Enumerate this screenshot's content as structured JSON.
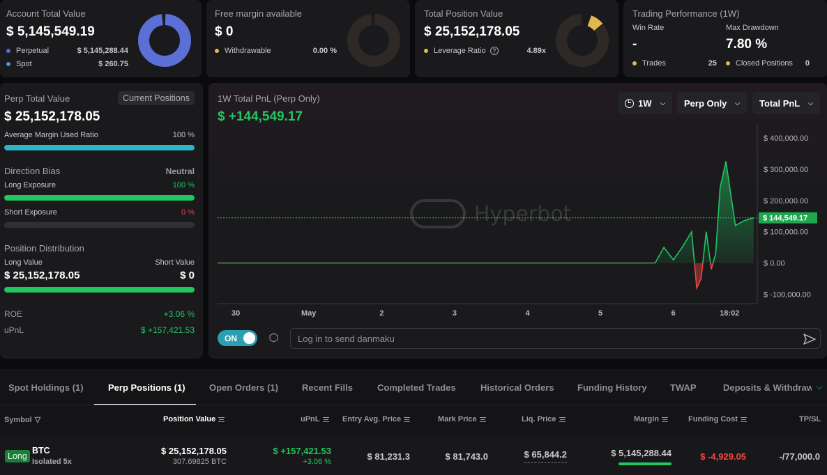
{
  "summary": {
    "account": {
      "title": "Account Total Value",
      "value": "$ 5,145,549.19",
      "perp_label": "Perpetual",
      "perp_value": "$ 5,145,288.44",
      "spot_label": "Spot",
      "spot_value": "$ 260.75",
      "perp_share": 0.99995
    },
    "margin": {
      "title": "Free margin available",
      "value": "$ 0",
      "withdrawable_label": "Withdrawable",
      "withdrawable_value": "0.00 %"
    },
    "position": {
      "title": "Total Position Value",
      "value": "$ 25,152,178.05",
      "leverage_label": "Leverage Ratio",
      "leverage_value": "4.89x",
      "leverage_share": 0.0978
    },
    "performance": {
      "title": "Trading Performance (1W)",
      "win_rate_label": "Win Rate",
      "win_rate_value": "-",
      "drawdown_label": "Max Drawdown",
      "drawdown_value": "7.80 %",
      "trades_label": "Trades",
      "trades_value": "25",
      "closed_label": "Closed Positions",
      "closed_value": "0"
    }
  },
  "perp": {
    "title": "Perp Total Value",
    "badge": "Current Positions",
    "value": "$ 25,152,178.05",
    "margin_ratio_label": "Average Margin Used Ratio",
    "margin_ratio_value": "100 %",
    "margin_ratio_fill": 1.0,
    "bias_label": "Direction Bias",
    "bias_value": "Neutral",
    "long_exp_label": "Long Exposure",
    "long_exp_value": "100 %",
    "long_exp_fill": 1.0,
    "short_exp_label": "Short Exposure",
    "short_exp_value": "0 %",
    "short_exp_fill": 0.0,
    "dist_label": "Position Distribution",
    "long_value_label": "Long Value",
    "short_value_label": "Short Value",
    "long_value": "$ 25,152,178.05",
    "short_value": "$ 0",
    "dist_long_fill": 1.0,
    "roe_label": "ROE",
    "roe_value": "+3.06 %",
    "upnl_label": "uPnL",
    "upnl_value": "$ +157,421.53"
  },
  "chart_panel": {
    "title": "1W Total PnL (Perp Only)",
    "value": "$ +144,549.17",
    "dropdowns": {
      "range": "1W",
      "scope": "Perp Only",
      "metric": "Total PnL"
    },
    "toggle": "ON",
    "danmaku_placeholder": "Log in to send danmaku",
    "watermark": "Hyperbot"
  },
  "chart_data": {
    "type": "area",
    "title": "1W Total PnL (Perp Only)",
    "y_ticks": [
      "$ 400,000.00",
      "$ 300,000.00",
      "$ 200,000.00",
      "$ 100,000.00",
      "$ 0.00",
      "$ -100,000.00"
    ],
    "y_tick_values": [
      400000,
      300000,
      200000,
      100000,
      0,
      -100000
    ],
    "x_ticks": [
      "30",
      "May",
      "2",
      "3",
      "4",
      "5",
      "6",
      "18:02"
    ],
    "x_tick_values": [
      0,
      1,
      2,
      3,
      4,
      5,
      6,
      6.77
    ],
    "ylim": [
      -130000,
      440000
    ],
    "xlim": [
      -0.25,
      7.15
    ],
    "last_value": 144549.17,
    "last_label": "$ 144,549.17",
    "x": [
      -0.25,
      5.75,
      5.87,
      6.0,
      6.12,
      6.25,
      6.32,
      6.38,
      6.45,
      6.52,
      6.58,
      6.64,
      6.72,
      6.85,
      6.97,
      7.1
    ],
    "y": [
      0,
      0,
      50000,
      10000,
      50000,
      100000,
      -80000,
      -50000,
      100000,
      -20000,
      30000,
      240000,
      325000,
      120000,
      135000,
      144549
    ]
  },
  "tabs": [
    "Spot Holdings (1)",
    "Perp Positions (1)",
    "Open Orders (1)",
    "Recent Fills",
    "Completed Trades",
    "Historical Orders",
    "Funding History",
    "TWAP",
    "Deposits & Withdraw"
  ],
  "table": {
    "headers": {
      "symbol": "Symbol",
      "position_value": "Position Value",
      "upnl": "uPnL",
      "entry": "Entry Avg. Price",
      "mark": "Mark Price",
      "liq": "Liq. Price",
      "margin": "Margin",
      "funding": "Funding Cost",
      "tpsl": "TP/SL"
    },
    "row": {
      "side": "Long",
      "symbol": "BTC",
      "mode": "Isolated 5x",
      "position_value": "$ 25,152,178.05",
      "position_size": "307.69825 BTC",
      "upnl": "$ +157,421.53",
      "upnl_pct": "+3.06 %",
      "entry": "$ 81,231.3",
      "mark": "$ 81,743.0",
      "liq": "$ 65,844.2",
      "margin": "$ 5,145,288.44",
      "funding": "$ -4,929.05",
      "tpsl": "-/77,000.0"
    }
  },
  "colors": {
    "accent_blue": "#5b6fd6",
    "gold": "#e0b84e",
    "green": "#22c55e",
    "red": "#ef4444",
    "cyan": "#2bb5c9"
  }
}
